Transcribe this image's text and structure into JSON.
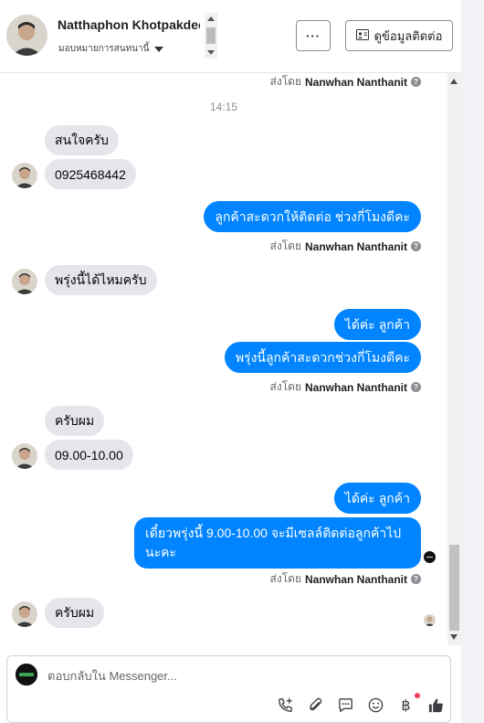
{
  "header": {
    "contact_name": "Natthaphon Khotpakdee",
    "assign_label": "มอบหมายการสนทนานี้",
    "more_button": "···",
    "contact_info_button": "ดูข้อมูลติดต่อ"
  },
  "chat": {
    "sent_by_prefix": "ส่งโดย",
    "agent_name": "Nanwhan Nanthanit",
    "timestamp": "14:15",
    "messages": [
      {
        "dir": "in",
        "text": "สนใจครับ"
      },
      {
        "dir": "in",
        "text": "0925468442"
      },
      {
        "dir": "out",
        "text": "ลูกค้าสะดวกให้ติดต่อ ช่วงกี่โมงดีคะ"
      },
      {
        "dir": "in",
        "text": "พรุ่งนี้ได้ไหมครับ"
      },
      {
        "dir": "out",
        "text": "ได้ค่ะ ลูกค้า"
      },
      {
        "dir": "out",
        "text": "พรุ่งนี้ลูกค้าสะดวกช่วงกี่โมงดีคะ"
      },
      {
        "dir": "in",
        "text": "ครับผม"
      },
      {
        "dir": "in",
        "text": "09.00-10.00"
      },
      {
        "dir": "out",
        "text": "ได้ค่ะ ลูกค้า"
      },
      {
        "dir": "out",
        "text": "เดี๋ยวพรุ่งนี้ 9.00-10.00 จะมีเซลล์ติดต่อลูกค้าไปนะคะ"
      },
      {
        "dir": "in",
        "text": "ครับผม"
      }
    ]
  },
  "composer": {
    "placeholder": "ตอบกลับใน Messenger..."
  },
  "icons": [
    "chevron-down-icon",
    "ellipsis-icon",
    "contact-card-icon",
    "help-icon",
    "add-call-icon",
    "attachment-icon",
    "saved-reply-icon",
    "emoji-icon",
    "payment-baht-icon",
    "thumbs-up-icon"
  ],
  "colors": {
    "outgoing_bubble": "#0084ff",
    "incoming_bubble": "#e4e6eb",
    "notification_dot": "#f3425f"
  }
}
